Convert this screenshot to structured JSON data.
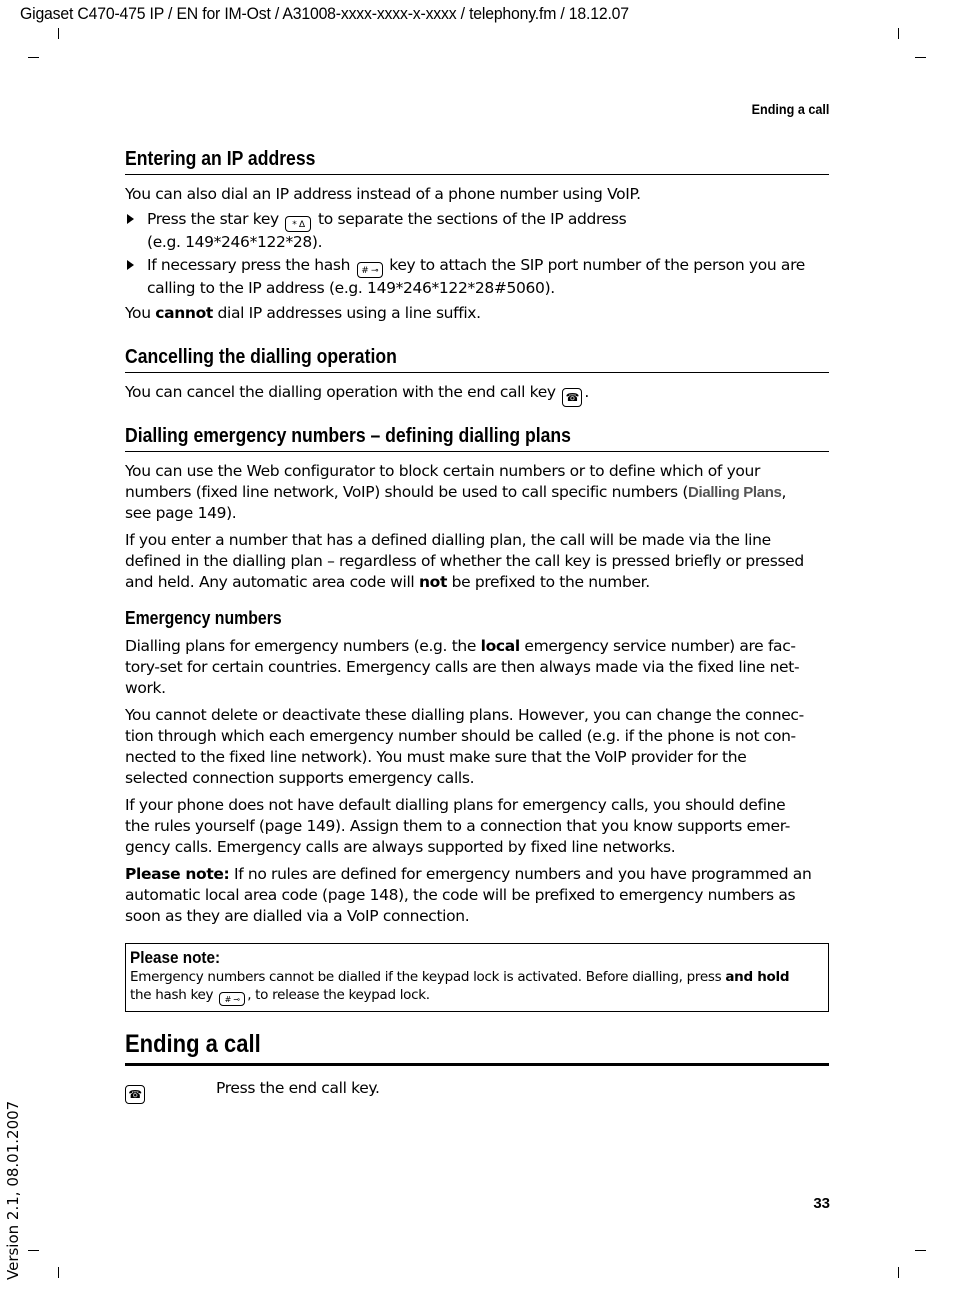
{
  "header": {
    "file_info": "Gigaset C470-475 IP / EN for IM-Ost / A31008-xxxx-xxxx-x-xxxx / telephony.fm / 18.12.07",
    "running_head": "Ending a call"
  },
  "sections": {
    "ip_address": {
      "heading": "Entering an IP address",
      "intro": "You can also dial an IP address instead of a phone number using VoIP.",
      "bullets": [
        {
          "before": "Press the star key ",
          "key_icon": "star-key",
          "key_glyph": "* ∆",
          "after": " to separate the sections of the IP address",
          "line2": "(e.g. 149*246*122*28)."
        },
        {
          "before": "If necessary press the hash ",
          "key_icon": "hash-key",
          "key_glyph": "# ⊸",
          "after": " key to attach the SIP port number of the person you are",
          "line2": "calling to the IP address (e.g. 149*246*122*28#5060)."
        }
      ],
      "outro_before": "You ",
      "outro_bold": "cannot",
      "outro_after": " dial IP addresses using a line suffix."
    },
    "cancelling": {
      "heading": "Cancelling the dialling operation",
      "text_before": "You can cancel the dialling operation with the end call key ",
      "key_glyph": "☎",
      "text_after": "."
    },
    "emergency": {
      "heading": "Dialling emergency numbers – defining dialling plans",
      "p1_line1": "You can use the Web configurator to block certain numbers or to define which of your",
      "p1_line2_before": "numbers (fixed line network, VoIP) should be used to call specific numbers (",
      "p1_ui_term": "Dialling Plans",
      "p1_line2_after": ",",
      "p1_line3": "see page 149).",
      "p2_line1": "If you enter a number that has a defined dialling plan, the call will be made via the line",
      "p2_line2": "defined in the dialling plan – regardless of whether the call key is pressed briefly or pressed",
      "p2_line3_before": "and held. Any automatic area code will ",
      "p2_bold": "not",
      "p2_line3_after": " be prefixed to the number.",
      "subheading": "Emergency numbers",
      "p3_line1_before": "Dialling plans for emergency numbers (e.g. the ",
      "p3_bold": "local",
      "p3_line1_after": " emergency service number) are fac-",
      "p3_line2": "tory-set for certain countries. Emergency calls are then always made via the fixed line net-",
      "p3_line3": "work.",
      "p4_line1": "You cannot delete or deactivate these dialling plans. However, you can change the connec-",
      "p4_line2": "tion through which each emergency number should be called (e.g. if the phone is not con-",
      "p4_line3": "nected to the fixed line network). You must make sure that the VoIP provider for the",
      "p4_line4": "selected connection supports emergency calls.",
      "p5_line1": "If your phone does not have default dialling plans for emergency calls, you should define",
      "p5_line2": "the rules yourself (page 149). Assign them to a connection that you know supports emer-",
      "p5_line3": "gency calls. Emergency calls are always supported by fixed line networks.",
      "p6_bold": "Please note:",
      "p6_line1_after": " If no rules are defined for emergency numbers and you have programmed an",
      "p6_line2": "automatic local area code (page 148), the code will be prefixed to emergency numbers as",
      "p6_line3": "soon as they are dialled via a VoIP connection."
    },
    "note_box": {
      "title": "Please note:",
      "line1_before": "Emergency numbers cannot be dialled if the keypad lock is activated. Before dialling, press ",
      "line1_bold": "and hold",
      "line2_before": "the hash key ",
      "key_glyph": "# ⊸",
      "line2_after": ", to release the keypad lock."
    },
    "ending_call": {
      "heading": "Ending a call",
      "key_glyph": "☎",
      "step_text": "Press the end call key."
    }
  },
  "footer": {
    "page_number": "33",
    "version": "Version 2.1, 08.01.2007"
  }
}
